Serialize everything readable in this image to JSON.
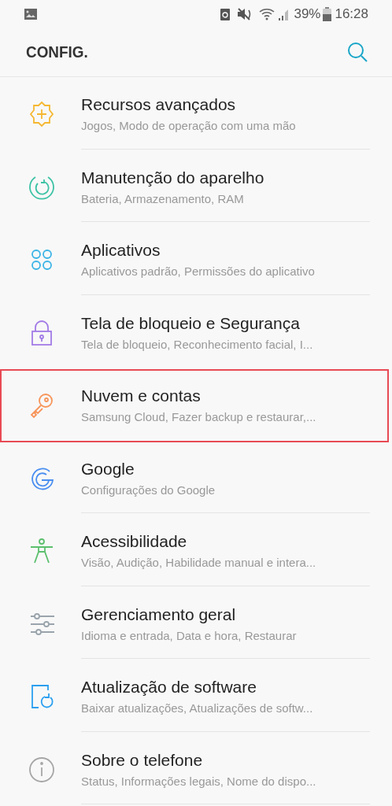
{
  "status_bar": {
    "battery_percent": "39%",
    "time": "16:28"
  },
  "app_bar": {
    "title": "CONFIG."
  },
  "settings": [
    {
      "kind": "puzzle",
      "color": "#f5b731",
      "title": "Recursos avançados",
      "subtitle": "Jogos, Modo de operação com uma mão",
      "highlighted": false
    },
    {
      "kind": "refresh",
      "color": "#3cc3a5",
      "title": "Manutenção do aparelho",
      "subtitle": "Bateria, Armazenamento, RAM",
      "highlighted": false
    },
    {
      "kind": "apps",
      "color": "#3ab4e6",
      "title": "Aplicativos",
      "subtitle": "Aplicativos padrão, Permissões do aplicativo",
      "highlighted": false
    },
    {
      "kind": "lock",
      "color": "#a27be6",
      "title": "Tela de bloqueio e Segurança",
      "subtitle": "Tela de bloqueio, Reconhecimento facial, I...",
      "highlighted": false
    },
    {
      "kind": "key",
      "color": "#f7955a",
      "title": "Nuvem e contas",
      "subtitle": "Samsung Cloud, Fazer backup e restaurar,...",
      "highlighted": true
    },
    {
      "kind": "google",
      "color": "#4a8ef0",
      "title": "Google",
      "subtitle": "Configurações do Google",
      "highlighted": false
    },
    {
      "kind": "person",
      "color": "#5cbf6e",
      "title": "Acessibilidade",
      "subtitle": "Visão, Audição, Habilidade manual e intera...",
      "highlighted": false
    },
    {
      "kind": "sliders",
      "color": "#9aa4ac",
      "title": "Gerenciamento geral",
      "subtitle": "Idioma e entrada, Data e hora, Restaurar",
      "highlighted": false
    },
    {
      "kind": "update",
      "color": "#2a9ff0",
      "title": "Atualização de software",
      "subtitle": "Baixar atualizações, Atualizações de softw...",
      "highlighted": false
    },
    {
      "kind": "info",
      "color": "#a6a6a6",
      "title": "Sobre o telefone",
      "subtitle": "Status, Informações legais, Nome do dispo...",
      "highlighted": false
    }
  ]
}
